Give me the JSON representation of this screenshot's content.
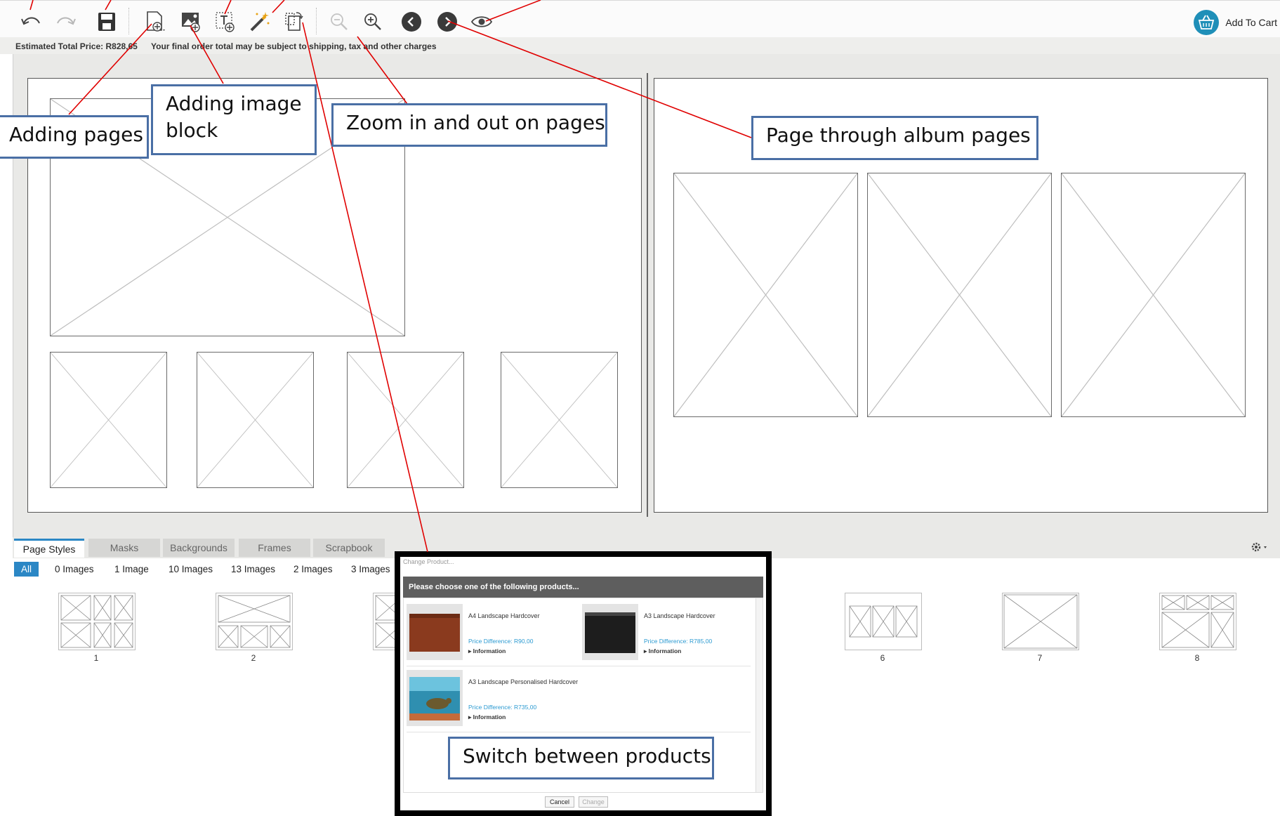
{
  "toolbar": {
    "buttons": [
      {
        "name": "undo-button",
        "icon": "undo-icon"
      },
      {
        "name": "redo-button",
        "icon": "redo-icon"
      },
      {
        "name": "save-button",
        "icon": "save-icon"
      },
      {
        "name": "add-page-button",
        "icon": "add-page-icon"
      },
      {
        "name": "add-image-block-button",
        "icon": "add-image-icon"
      },
      {
        "name": "add-text-block-button",
        "icon": "add-text-icon"
      },
      {
        "name": "magic-wand-button",
        "icon": "magic-wand-icon"
      },
      {
        "name": "change-product-button",
        "icon": "change-product-icon"
      },
      {
        "name": "zoom-out-button",
        "icon": "zoom-out-icon"
      },
      {
        "name": "zoom-in-button",
        "icon": "zoom-in-icon"
      },
      {
        "name": "previous-page-button",
        "icon": "chevron-left-icon"
      },
      {
        "name": "next-page-button",
        "icon": "chevron-right-icon"
      },
      {
        "name": "preview-button",
        "icon": "eye-icon"
      }
    ],
    "add_to_cart": "Add To Cart"
  },
  "price_bar": {
    "estimated": "Estimated Total Price: R828,65",
    "note": "Your final order total may be subject to shipping, tax and other charges"
  },
  "bottom_panel": {
    "tabs": [
      "Page Styles",
      "Masks",
      "Backgrounds",
      "Frames",
      "Scrapbook"
    ],
    "active_tab": "Page Styles",
    "filters": [
      "All",
      "0 Images",
      "1 Image",
      "10 Images",
      "13 Images",
      "2 Images",
      "3 Images"
    ],
    "active_filter": "All",
    "thumbnails": [
      "1",
      "2",
      "6",
      "7",
      "8"
    ]
  },
  "dialog": {
    "title": "Change Product...",
    "header": "Please choose one of the following products...",
    "products": [
      {
        "name": "A4 Landscape Hardcover",
        "price_diff": "Price Difference: R90,00",
        "info": "▸ Information",
        "cover_color": "#8a3a1e"
      },
      {
        "name": "A3 Landscape Hardcover",
        "price_diff": "Price Difference: R785,00",
        "info": "▸ Information",
        "cover_color": "#1d1d1d"
      },
      {
        "name": "A3 Landscape Personalised Hardcover",
        "price_diff": "Price Difference: R735,00",
        "info": "▸ Information",
        "cover_color": "#2f8fb0"
      }
    ],
    "cancel": "Cancel",
    "change": "Change"
  },
  "callouts": {
    "adding_pages": "Adding pages",
    "adding_image_block": "Adding image block",
    "zoom": "Zoom in and out on pages",
    "page_through": "Page through album pages",
    "switch_products": "Switch between products"
  },
  "colors": {
    "accent": "#2b87c5",
    "callout_border": "#4a6fa5",
    "annotation_line": "#e00000",
    "cart_icon_bg": "#1f8fb8"
  }
}
